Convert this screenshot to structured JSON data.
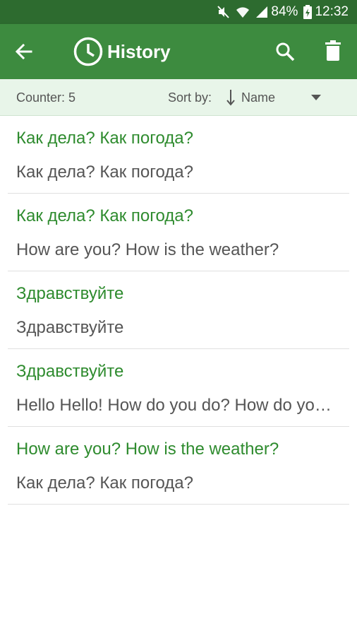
{
  "status_bar": {
    "battery": "84%",
    "time": "12:32",
    "icons": [
      "mute-icon",
      "wifi-icon",
      "signal-icon",
      "battery-charging-icon"
    ]
  },
  "app_bar": {
    "title": "History",
    "icons": [
      "back-arrow-icon",
      "clock-icon",
      "search-icon",
      "trash-icon"
    ]
  },
  "sort_bar": {
    "counter": "Counter: 5",
    "sort_label": "Sort by:",
    "sort_value": "Name"
  },
  "history": [
    {
      "source": "Как дела? Как погода?",
      "translation": "Как дела? Как погода?"
    },
    {
      "source": "Как дела? Как погода?",
      "translation": "How are you? How is the weather?"
    },
    {
      "source": "Здравствуйте",
      "translation": "Здравствуйте"
    },
    {
      "source": "Здравствуйте",
      "translation": "Hello  Hello! How do you do? How do you do?"
    },
    {
      "source": "How are you? How is the weather?",
      "translation": "Как дела? Как погода?"
    }
  ],
  "colors": {
    "status_bar": "#2d6b2f",
    "app_bar": "#3d8b3f",
    "sort_bar": "#e8f5e9",
    "source_text": "#2e8b2e",
    "translation_text": "#555555"
  }
}
